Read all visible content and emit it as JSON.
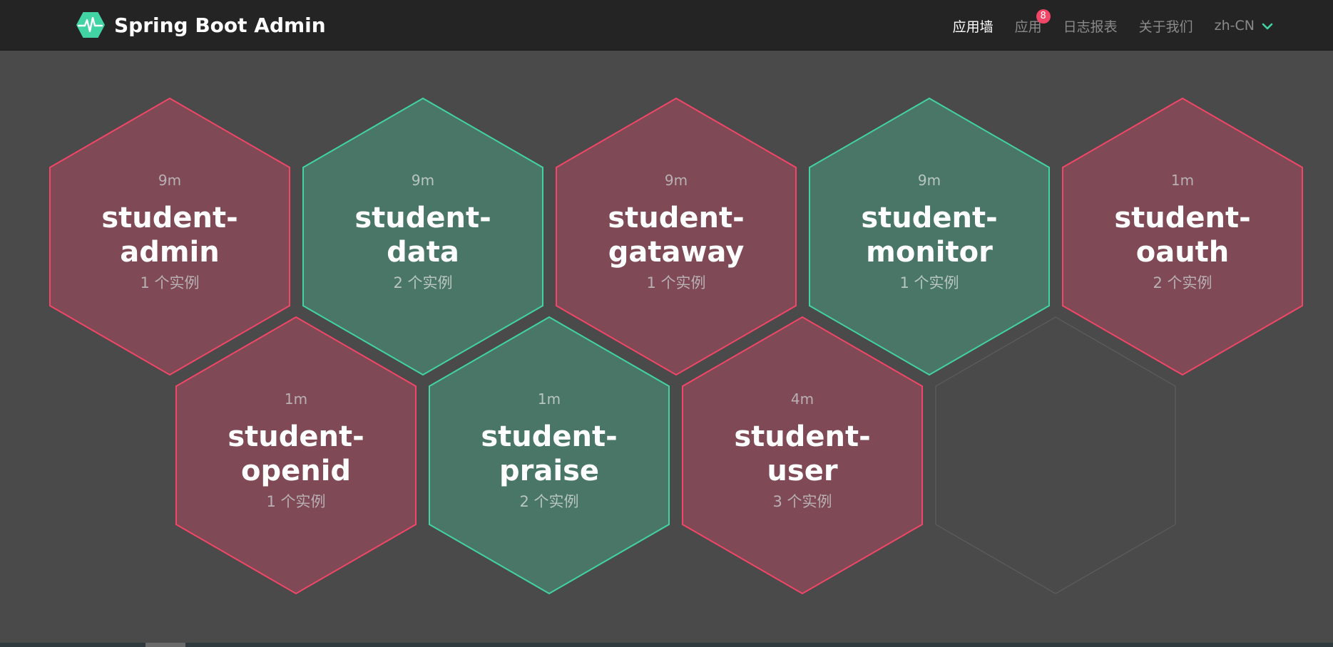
{
  "header": {
    "brand_title": "Spring Boot Admin",
    "logo_icon": "heartbeat-hexagon-icon",
    "accent_color": "#42d3a5",
    "nav": {
      "wall": "应用墙",
      "applications": "应用",
      "applications_badge": "8",
      "journal": "日志报表",
      "about": "关于我们",
      "language": "zh-CN"
    }
  },
  "colors": {
    "down_fill": "#7f4a55",
    "down_stroke": "#f14668",
    "up_fill": "#4a7668",
    "up_stroke": "#42d3a5",
    "empty_stroke": "#5a5a5a"
  },
  "applications": [
    {
      "status": "down",
      "uptime": "9m",
      "name_line1": "student-",
      "name_line2": "admin",
      "instances": "1 个实例"
    },
    {
      "status": "up",
      "uptime": "9m",
      "name_line1": "student-",
      "name_line2": "data",
      "instances": "2 个实例"
    },
    {
      "status": "down",
      "uptime": "9m",
      "name_line1": "student-",
      "name_line2": "gataway",
      "instances": "1 个实例"
    },
    {
      "status": "up",
      "uptime": "9m",
      "name_line1": "student-",
      "name_line2": "monitor",
      "instances": "1 个实例"
    },
    {
      "status": "down",
      "uptime": "1m",
      "name_line1": "student-",
      "name_line2": "oauth",
      "instances": "2 个实例"
    },
    {
      "status": "down",
      "uptime": "1m",
      "name_line1": "student-",
      "name_line2": "openid",
      "instances": "1 个实例"
    },
    {
      "status": "up",
      "uptime": "1m",
      "name_line1": "student-",
      "name_line2": "praise",
      "instances": "2 个实例"
    },
    {
      "status": "down",
      "uptime": "4m",
      "name_line1": "student-",
      "name_line2": "user",
      "instances": "3 个实例"
    }
  ]
}
